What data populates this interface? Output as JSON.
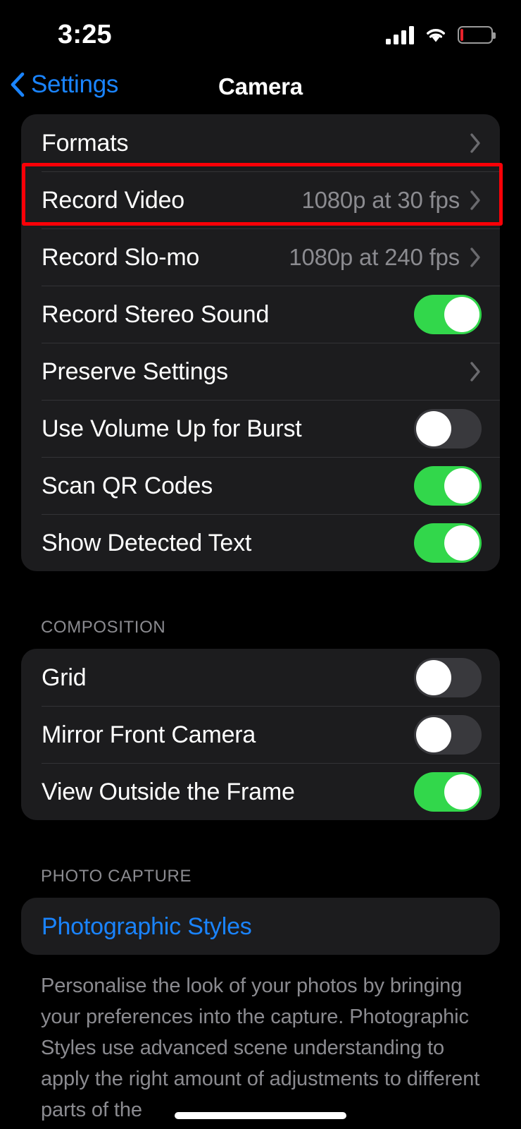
{
  "status_bar": {
    "time": "3:25",
    "cellular_icon": "cellular-signal-icon",
    "wifi_icon": "wifi-icon",
    "battery_icon": "battery-low-icon",
    "battery_level_pct": 10,
    "battery_color": "#e8232c"
  },
  "nav": {
    "back_label": "Settings",
    "back_icon": "chevron-left-icon",
    "title": "Camera",
    "accent_color": "#1a84ff"
  },
  "sections": [
    {
      "header": "",
      "rows": [
        {
          "label": "Formats",
          "type": "disclosure",
          "value": "",
          "highlighted": true
        },
        {
          "label": "Record Video",
          "type": "disclosure",
          "value": "1080p at 30 fps"
        },
        {
          "label": "Record Slo-mo",
          "type": "disclosure",
          "value": "1080p at 240 fps"
        },
        {
          "label": "Record Stereo Sound",
          "type": "toggle",
          "on": true
        },
        {
          "label": "Preserve Settings",
          "type": "disclosure",
          "value": ""
        },
        {
          "label": "Use Volume Up for Burst",
          "type": "toggle",
          "on": false
        },
        {
          "label": "Scan QR Codes",
          "type": "toggle",
          "on": true
        },
        {
          "label": "Show Detected Text",
          "type": "toggle",
          "on": true
        }
      ]
    },
    {
      "header": "COMPOSITION",
      "rows": [
        {
          "label": "Grid",
          "type": "toggle",
          "on": false
        },
        {
          "label": "Mirror Front Camera",
          "type": "toggle",
          "on": false
        },
        {
          "label": "View Outside the Frame",
          "type": "toggle",
          "on": true
        }
      ]
    },
    {
      "header": "PHOTO CAPTURE",
      "rows": [
        {
          "label": "Photographic Styles",
          "type": "link"
        }
      ],
      "footer": "Personalise the look of your photos by bringing your preferences into the capture. Photographic Styles use advanced scene understanding to apply the right amount of adjustments to different parts of the"
    }
  ],
  "annotation": {
    "target": "Formats",
    "color": "#fb0007"
  },
  "colors": {
    "background": "#000000",
    "card": "#1c1c1e",
    "toggle_on": "#32d74b",
    "toggle_off": "#39393d",
    "secondary_text": "#8b8b90"
  }
}
